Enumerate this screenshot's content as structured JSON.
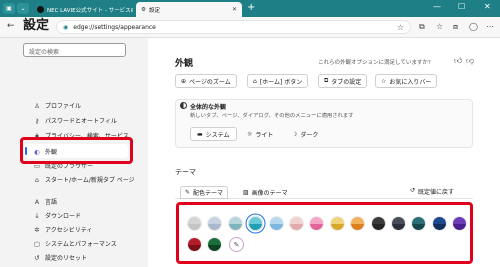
{
  "browser": {
    "tab1_title": "NEC LAVIE公式サイト - サービス&",
    "tab2_title": "設定",
    "new_tab": "+",
    "url": "edge://settings/appearance"
  },
  "sidebar": {
    "title": "設定",
    "search_placeholder": "設定の検索",
    "items": [
      {
        "label": "プロファイル",
        "icon": "person-icon"
      },
      {
        "label": "パスワードとオートフィル",
        "icon": "key-icon"
      },
      {
        "label": "プライバシー、検索、サービス",
        "icon": "lock-icon"
      },
      {
        "label": "外観",
        "icon": "palette-icon",
        "active": true
      },
      {
        "label": "既定のブラウザー",
        "icon": "browser-icon"
      },
      {
        "label": "スタート/ホーム/新規タブ ページ",
        "icon": "home-icon"
      },
      {
        "label": "言語",
        "icon": "language-icon"
      },
      {
        "label": "ダウンロード",
        "icon": "download-icon"
      },
      {
        "label": "アクセシビリティ",
        "icon": "accessibility-icon"
      },
      {
        "label": "システムとパフォーマンス",
        "icon": "computer-icon"
      },
      {
        "label": "設定のリセット",
        "icon": "reset-icon"
      }
    ]
  },
  "main": {
    "title": "外観",
    "feedback": "これらの外観オプションに満足していますか?",
    "quick_buttons": [
      "ページのズーム",
      "[ホーム] ボタン",
      "タブの設定",
      "お気に入りバー"
    ],
    "overall": {
      "title": "全体的な外観",
      "description": "新しいタブ、ページ、ダイアログ、その他のメニューに適用されます",
      "modes": [
        "システム",
        "ライト",
        "ダーク"
      ],
      "selected_mode": "システム"
    },
    "theme": {
      "heading": "テーマ",
      "tabs": [
        "配色テーマ",
        "画像のテーマ"
      ],
      "reset_label": "既定値に戻す",
      "selected_swatch_index": 3,
      "swatches": [
        {
          "top": "#d5d5d5",
          "bottom": "#c4c4c4"
        },
        {
          "top": "#c7d3e2",
          "bottom": "#a9b9cc"
        },
        {
          "top": "#b8d6dc",
          "bottom": "#7fb4bf"
        },
        {
          "top": "#69c9d6",
          "bottom": "#1f9fb1"
        },
        {
          "top": "#b6d9f0",
          "bottom": "#7cb7e0"
        },
        {
          "top": "#f0d2d2",
          "bottom": "#e2aaaa"
        },
        {
          "top": "#f4a6c6",
          "bottom": "#e26498"
        },
        {
          "top": "#f1d37a",
          "bottom": "#d9a72c"
        },
        {
          "top": "#f2b25b",
          "bottom": "#dd7f1d"
        },
        {
          "top": "#3b3b3b",
          "bottom": "#262626"
        },
        {
          "top": "#474e5a",
          "bottom": "#2b313b"
        },
        {
          "top": "#2a6f75",
          "bottom": "#17484d"
        },
        {
          "top": "#1d4a8c",
          "bottom": "#102d5c"
        },
        {
          "top": "#6d3cb8",
          "bottom": "#4b1f8e"
        },
        {
          "top": "#b51d2a",
          "bottom": "#7a0f19"
        },
        {
          "top": "#1b6f3a",
          "bottom": "#0f4323"
        }
      ]
    }
  }
}
